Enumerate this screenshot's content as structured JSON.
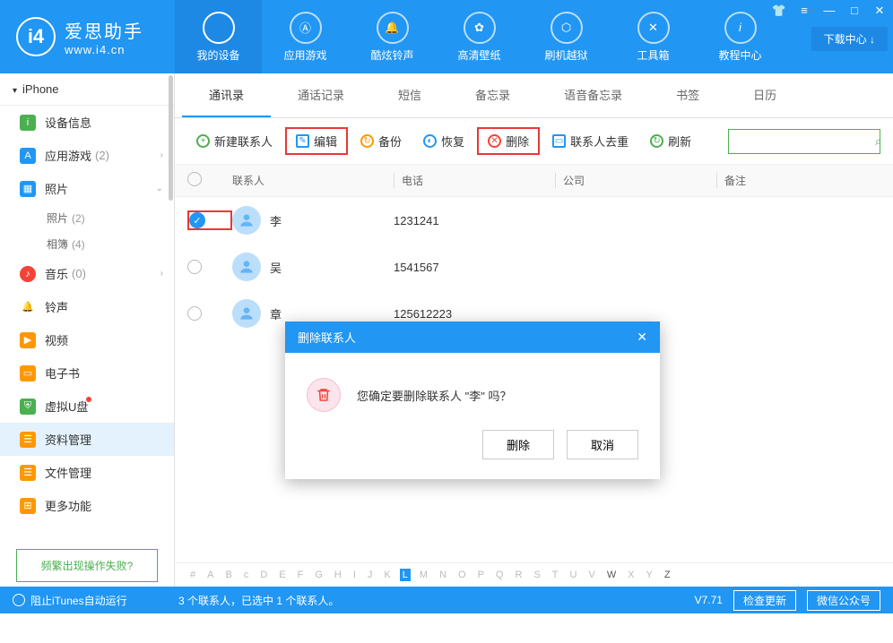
{
  "app": {
    "name": "爱思助手",
    "url": "www.i4.cn",
    "logo_text": "i4"
  },
  "window": {
    "download_center": "下载中心 ↓"
  },
  "nav": [
    {
      "label": "我的设备"
    },
    {
      "label": "应用游戏"
    },
    {
      "label": "酷炫铃声"
    },
    {
      "label": "高清壁纸"
    },
    {
      "label": "刷机越狱"
    },
    {
      "label": "工具箱"
    },
    {
      "label": "教程中心"
    }
  ],
  "sidebar": {
    "device": "iPhone",
    "items": [
      {
        "icon": "ℹ",
        "bg": "#4caf50",
        "label": "设备信息"
      },
      {
        "icon": "A",
        "bg": "#2196f3",
        "label": "应用游戏",
        "count": "(2)",
        "chev": true
      },
      {
        "icon": "▦",
        "bg": "#2196f3",
        "label": "照片",
        "chev": true
      },
      {
        "icon": "♪",
        "bg": "#f44336",
        "label": "音乐",
        "count": "(0)",
        "chev": true
      },
      {
        "icon": "🔔",
        "bg": "#2196f3",
        "label": "铃声"
      },
      {
        "icon": "▶",
        "bg": "#ff9800",
        "label": "视频"
      },
      {
        "icon": "▭",
        "bg": "#ff9800",
        "label": "电子书"
      },
      {
        "icon": "⛨",
        "bg": "#4caf50",
        "label": "虚拟U盘",
        "dot": true
      },
      {
        "icon": "☰",
        "bg": "#ff9800",
        "label": "资料管理",
        "active": true
      },
      {
        "icon": "☰",
        "bg": "#ff9800",
        "label": "文件管理"
      },
      {
        "icon": "⊞",
        "bg": "#ff9800",
        "label": "更多功能"
      }
    ],
    "photo_sub": [
      {
        "label": "照片",
        "count": "(2)"
      },
      {
        "label": "相簿",
        "count": "(4)"
      }
    ],
    "help": "频繁出现操作失败?"
  },
  "tabs": [
    "通讯录",
    "通话记录",
    "短信",
    "备忘录",
    "语音备忘录",
    "书签",
    "日历"
  ],
  "toolbar": {
    "new": "新建联系人",
    "edit": "编辑",
    "backup": "备份",
    "restore": "恢复",
    "delete": "删除",
    "dedupe": "联系人去重",
    "refresh": "刷新"
  },
  "columns": {
    "name": "联系人",
    "phone": "电话",
    "company": "公司",
    "note": "备注"
  },
  "contacts": [
    {
      "name": "李",
      "phone": "1231241",
      "checked": true
    },
    {
      "name": "吴",
      "phone": "1541567",
      "checked": false
    },
    {
      "name": "章",
      "phone": "125612223",
      "checked": false
    }
  ],
  "alpha": {
    "letters": [
      "#",
      "A",
      "B",
      "c",
      "D",
      "E",
      "F",
      "G",
      "H",
      "I",
      "J",
      "K",
      "L",
      "M",
      "N",
      "O",
      "P",
      "Q",
      "R",
      "S",
      "T",
      "U",
      "V",
      "W",
      "X",
      "Y",
      "Z"
    ],
    "active": "L",
    "has": [
      "L",
      "W",
      "Z"
    ]
  },
  "status": {
    "itunes": "阻止iTunes自动运行",
    "summary": "3 个联系人，已选中 1 个联系人。",
    "version": "V7.71",
    "check_update": "检查更新",
    "wechat": "微信公众号"
  },
  "dialog": {
    "title": "删除联系人",
    "message": "您确定要删除联系人 \"李\" 吗？",
    "ok": "删除",
    "cancel": "取消"
  }
}
